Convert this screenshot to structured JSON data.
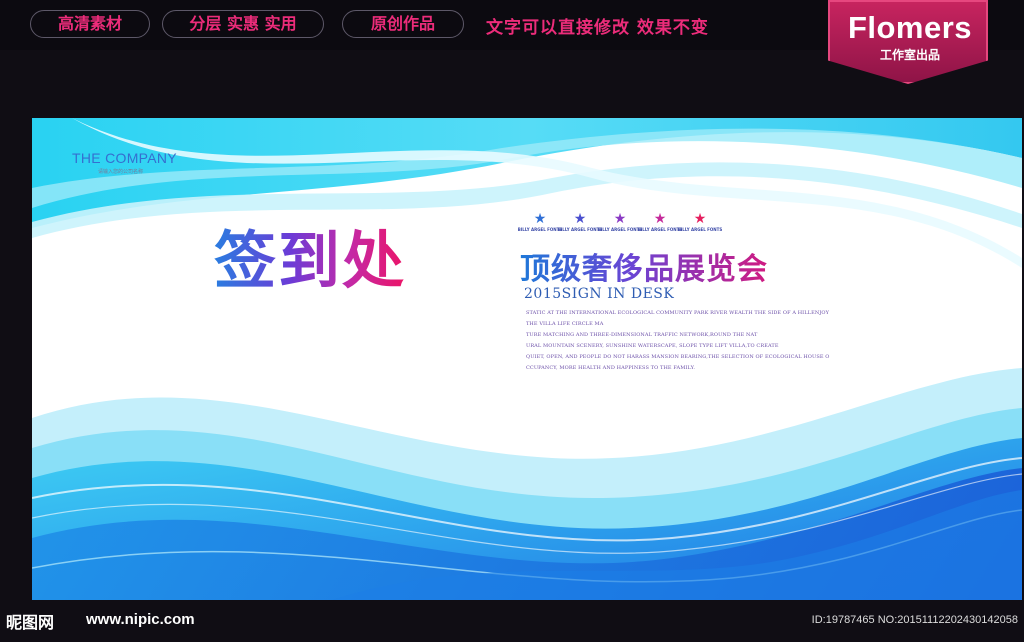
{
  "topbar": {
    "pills": [
      "高清素材",
      "分层 实惠 实用",
      "原创作品"
    ],
    "tagline": "文字可以直接修改  效果不变",
    "brand_name": "Flomers",
    "brand_sub": "工作室出品"
  },
  "banner": {
    "company": "THE COMPANY",
    "company_sub": "请输入您的公司名称",
    "title_big": "签到处",
    "title_2": "顶级奢侈品展览会",
    "stars": [
      {
        "text": "BILLY ARGEL FONTS",
        "color": "#2f6fd6"
      },
      {
        "text": "BILLY ARGEL FONTS",
        "color": "#4a4fcf"
      },
      {
        "text": "BILLY ARGEL FONTS",
        "color": "#8a3ac4"
      },
      {
        "text": "BILLY ARGEL FONTS",
        "color": "#c52a9a"
      },
      {
        "text": "BILLY ARGEL FONTS",
        "color": "#e51f5e"
      }
    ],
    "subtitle": "2015SIGN IN DESK",
    "paragraph": [
      "STATIC AT THE INTERNATIONAL ECOLOGICAL COMMUNITY PARK RIVER WEALTH THE SIDE OF A HILLENJOY",
      "THE VILLA LIFE CIRCLE MA",
      "TURE MATCHING AND THREE-DIMENSIONAL TRAFFIC NETWORK,ROUND THE NAT",
      "URAL MOUNTAIN SCENERY, SUNSHINE WATERSCAPE, SLOPE TYPE LIFT VILLA,TO CREATE",
      "QUIET, OPEN, AND PEOPLE DO NOT HARASS MANSION BEARING,THE SELECTION OF ECOLOGICAL HOUSE O",
      "CCUPANCY, MORE HEALTH AND HAPPINESS TO THE FAMILY."
    ]
  },
  "footer": {
    "logo": "昵图网",
    "url": "www.nipic.com",
    "id_text": "ID:19787465 NO:20151112202430142058"
  },
  "colors": {
    "accent_pink": "#ec2c7a",
    "brand_bg": "#c7245f",
    "sky_blue": "#2ad0f0",
    "deep_blue": "#1f6fe0"
  }
}
